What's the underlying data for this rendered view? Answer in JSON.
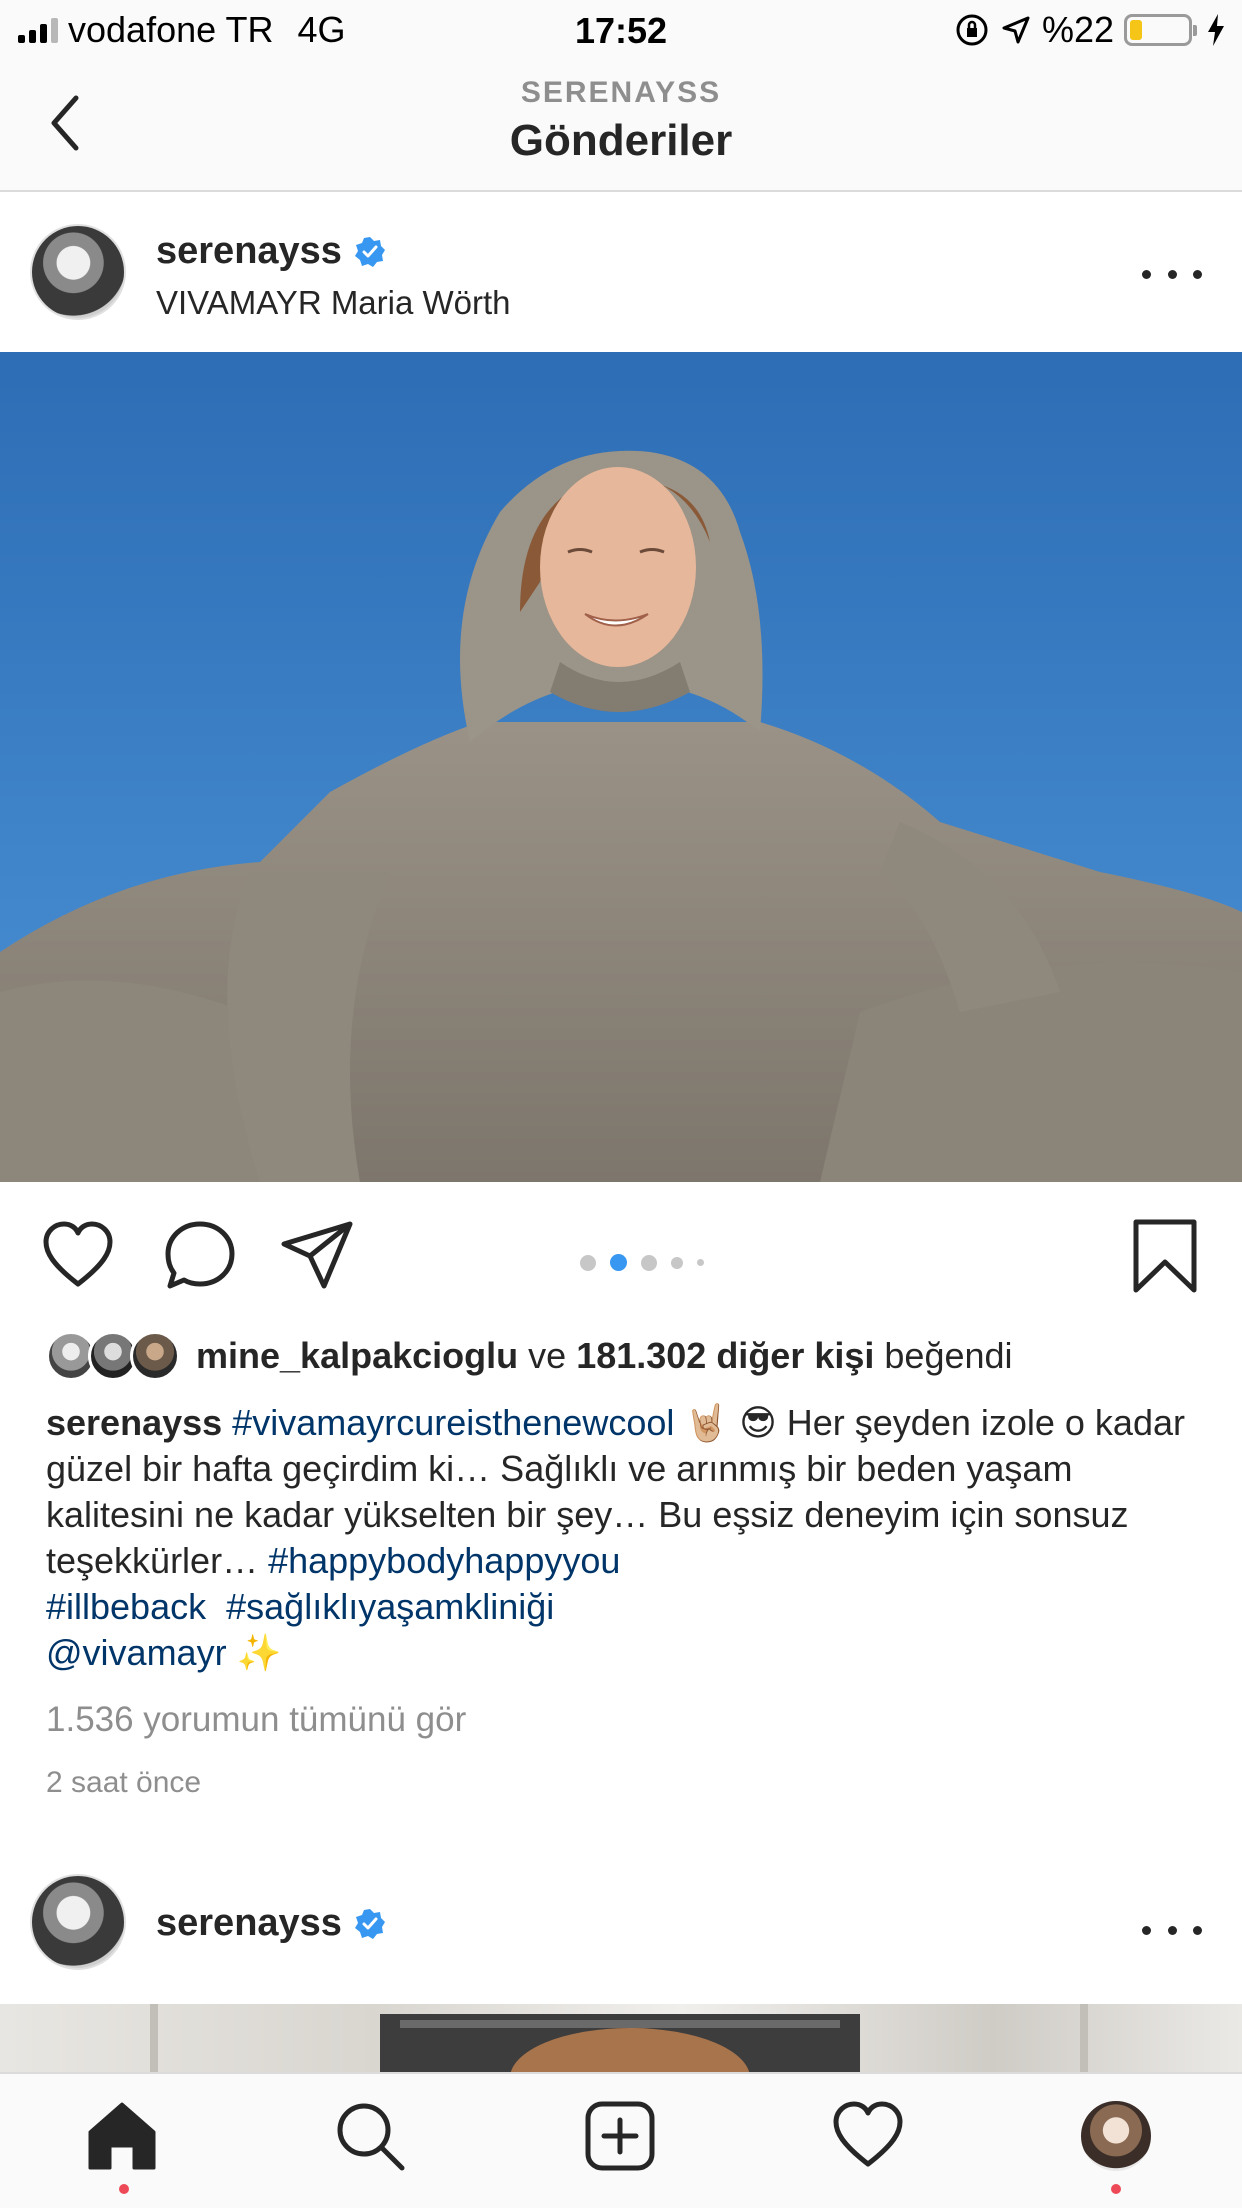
{
  "status_bar": {
    "carrier": "vodafone TR",
    "network": "4G",
    "time": "17:52",
    "battery_percent": "%22",
    "battery_level": 0.22,
    "icons": [
      "signal-icon",
      "orientation-lock-icon",
      "location-arrow-icon",
      "battery-icon",
      "charging-bolt-icon"
    ]
  },
  "nav": {
    "subtitle": "SERENAYSS",
    "title": "Gönderiler",
    "back_icon": "chevron-left-icon"
  },
  "post1": {
    "username": "serenayss",
    "verified": true,
    "location": "VIVAMAYR Maria Wörth",
    "carousel": {
      "count": 5,
      "active_index": 1
    },
    "likes": {
      "first_liker": "mine_kalpakcioglu",
      "connector": "ve",
      "others": "181.302 diğer kişi",
      "suffix": "beğendi"
    },
    "caption": {
      "author": "serenayss",
      "tag1": "#vivamayrcureisthenewcool",
      "emojis1": "🤘🏼 😎",
      "text1": "Her şeyden izole o kadar güzel bir hafta geçirdim ki… Sağlıklı ve arınmış bir beden yaşam kalitesini ne kadar yükselten bir şey… Bu eşsiz deneyim için sonsuz teşekkürler…",
      "tag2": "#happybodyhappyyou",
      "tag3": "#illbeback",
      "tag4": "#sağlıklıyaşamkliniği",
      "mention": "@vivamayr",
      "emoji2": "✨"
    },
    "view_comments": "1.536 yorumun tümünü gör",
    "time_ago": "2 saat önce"
  },
  "post2": {
    "username": "serenayss",
    "verified": true
  },
  "colors": {
    "accent_blue": "#3897f0",
    "link_blue": "#003569",
    "notification_red": "#ed4956",
    "sky_blue": "#3a80c8"
  },
  "tab_bar": [
    "home-icon",
    "search-icon",
    "add-post-icon",
    "activity-heart-icon",
    "profile-avatar"
  ]
}
